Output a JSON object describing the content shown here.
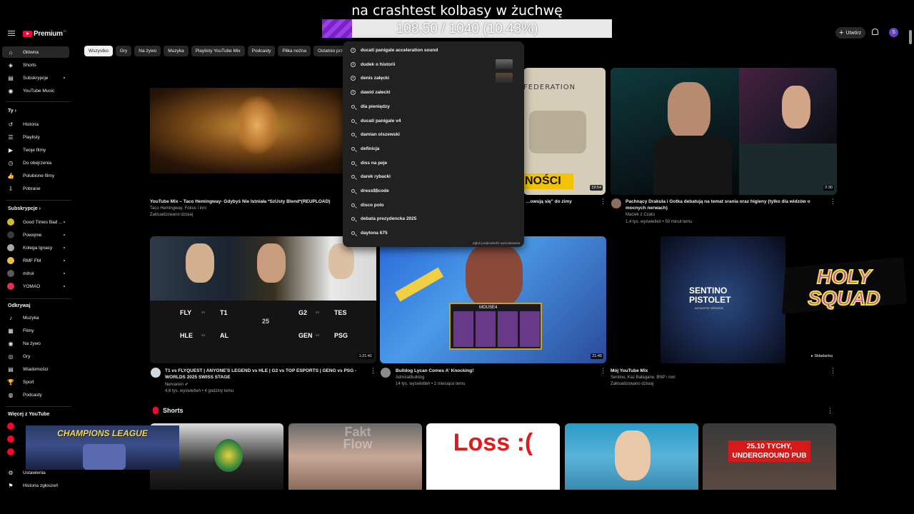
{
  "overlay": {
    "title": "na crashtest kolbasy w żuchwę",
    "goal_text": "108.50 / 1040 (10.43%)",
    "goal_progress": 0.1043,
    "holy_squad_logo": "HOLY SQUAD",
    "champions_league_logo": "CHAMPIONS LEAGUE"
  },
  "topbar": {
    "logo_text": "Premium",
    "logo_sup": "PL",
    "create_label": "Utwórz",
    "avatar_letter": "S"
  },
  "chips": [
    "Wszystko",
    "Gry",
    "Na żywo",
    "Muzyka",
    "Playlisty YouTube Mix",
    "Podcasty",
    "Piłka nożna",
    "Ostatnio prze"
  ],
  "sidebar": {
    "main": [
      "Główna",
      "Shorts",
      "Subskrypcje",
      "YouTube Music"
    ],
    "you_heading": "Ty",
    "you": [
      "Historia",
      "Playlisty",
      "Twoje filmy",
      "Do obejrzenia",
      "Polubione filmy",
      "Pobrane"
    ],
    "subs_heading": "Subskrypcje",
    "subs": [
      "Good Times Bad ...",
      "Powojnie",
      "Kolega Ignacy",
      "RMF FM",
      "mihol",
      "YOMAO"
    ],
    "explore_heading": "Odkrywaj",
    "explore": [
      "Muzyka",
      "Filmy",
      "Na żywo",
      "Gry",
      "Wiadomości",
      "Sport",
      "Podcasty"
    ],
    "more_heading": "Więcej z YouTube",
    "bottom": [
      "Ustawienia",
      "Historia zgłoszeń"
    ]
  },
  "search_suggestions": [
    "ducati panigale acceleration sound",
    "dudek o historii",
    "denis załęcki",
    "dawid załecki",
    "dla pieniędzy",
    "ducati panigale v4",
    "damian olszewski",
    "definicja",
    "diss na peje",
    "darek rybacki",
    "dress$$code",
    "disco polo",
    "debata prezydencka 2025",
    "daytona 675"
  ],
  "search_report": "Zgłoś podpowiedzi wyszukiwania",
  "videos": [
    {
      "title": "YouTube Mix – Taco Hemingway- Gdybyś Nie Istniała *SzUsty Blend*(REUPLOAD)",
      "channel": "Taco Hemingway, Fokus i inni",
      "meta": "Zaktualizowano dzisiaj"
    },
    {
      "title": "…owują się\" do zimy",
      "thumb_text": "NOŚCI",
      "map_text": "FEDERATION",
      "duration": "19:54"
    },
    {
      "title": "Pachnący Drakula i Gotka debatują na temat srania oraz higieny (tylko dla widzów o mocnych nerwach)",
      "channel": "Maciek z Czatu",
      "meta": "1,4 tys. wyświetleń • 50 minut temu",
      "duration": "2:30"
    },
    {
      "title": "T1 vs FLYQUEST | ANYONE'S LEGEND vs HLE | G2 vs TOP ESPORTS | GENG vs PSG - WORLDS 2025 SWISS STAGE",
      "channel": "Nervarien",
      "meta": "4,6 tys. wyświetleń • 4 godziny temu",
      "duration": "1:21:41",
      "teams": [
        "FLY",
        "T1",
        "G2",
        "TES",
        "HLE",
        "AL",
        "GEN",
        "PSG"
      ],
      "vs": "vs",
      "round": "25"
    },
    {
      "title": "Bulldog Lycan Comes A' Knocking!",
      "channel": "AdmiralBulldog",
      "meta": "14 tys. wyświetleń • 2 miesiące temu",
      "duration": "21:45",
      "hud_label": "MOUSE4"
    },
    {
      "title": "Mój YouTube Mix",
      "channel": "Sentino, Kaz Bałagane, BNP i inni",
      "meta": "Zaktualizowano dzisiaj",
      "thumb_title": "SENTINO PISTOLET",
      "thumb_sub": "ACOUSTIC VERSION",
      "badge": "Składanka"
    }
  ],
  "shorts": {
    "heading": "Shorts",
    "items": [
      "",
      "Fakt Flow",
      "Loss :(",
      "",
      "25.10 TYCHY, UNDERGROUND PUB"
    ]
  }
}
